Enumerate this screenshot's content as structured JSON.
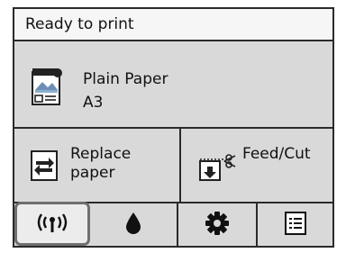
{
  "status": {
    "text": "Ready to print"
  },
  "paper": {
    "type": "Plain Paper",
    "size": "A3"
  },
  "actions": {
    "replace_label_line1": "Replace",
    "replace_label_line2": "paper",
    "feed_cut_label": "Feed/Cut"
  },
  "tabs": [
    {
      "name": "network",
      "icon": "wireless-signal-icon",
      "selected": true
    },
    {
      "name": "ink",
      "icon": "ink-drop-icon",
      "selected": false
    },
    {
      "name": "settings",
      "icon": "gear-icon",
      "selected": false
    },
    {
      "name": "menu",
      "icon": "list-menu-icon",
      "selected": false
    }
  ],
  "colors": {
    "panel_bg": "#d9d9d9",
    "status_bg": "#f6f6f6",
    "border": "#2a2a2a",
    "selected_tab_bg": "#ececec"
  }
}
